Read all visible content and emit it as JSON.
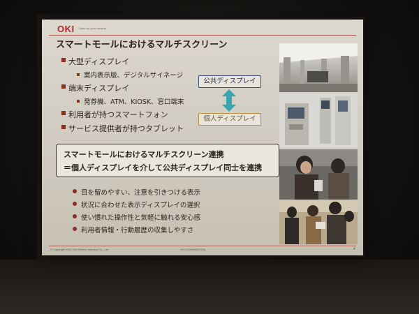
{
  "slide": {
    "logo": "OKI",
    "tagline": "Open up your dreams",
    "title": "スマートモールにおけるマルチスクリーン",
    "bullets": [
      {
        "label": "大型ディスプレイ",
        "subs": [
          "案内表示版、デジタルサイネージ"
        ]
      },
      {
        "label": "端末ディスプレイ",
        "subs": [
          "発券機、ATM、KIOSK、窓口端末"
        ]
      },
      {
        "label": "利用者が持つスマートフォン",
        "subs": []
      },
      {
        "label": "サービス提供者が持つタブレット",
        "subs": []
      }
    ],
    "public_display_label": "公共ディスプレイ",
    "personal_display_label": "個人ディスプレイ",
    "callout_line1": "スマートモールにおけるマルチスクリーン連携",
    "callout_line2": "＝個人ディスプレイを介して公共ディスプレイ同士を連携",
    "points": [
      "目を留めやすい、注意を引きつける表示",
      "状況に合わせた表示ディスプレイの選択",
      "使い慣れた操作性と気軽に触れる安心感",
      "利用者情報・行動履歴の収集しやすさ"
    ],
    "copyright": "© Copyright 2012 Oki Electric Industry Co., Ltd.",
    "confidential": "OKI CONFIDENTIAL",
    "page_number": "4"
  },
  "colors": {
    "brand_red": "#b3262a",
    "bullet_marker": "#8a2e20",
    "public_border": "#3d4f77",
    "personal_border": "#b6903f",
    "arrow_fill": "#3aa6b0"
  },
  "icons": {
    "link_arrow": "double-arrow-vertical-icon"
  }
}
